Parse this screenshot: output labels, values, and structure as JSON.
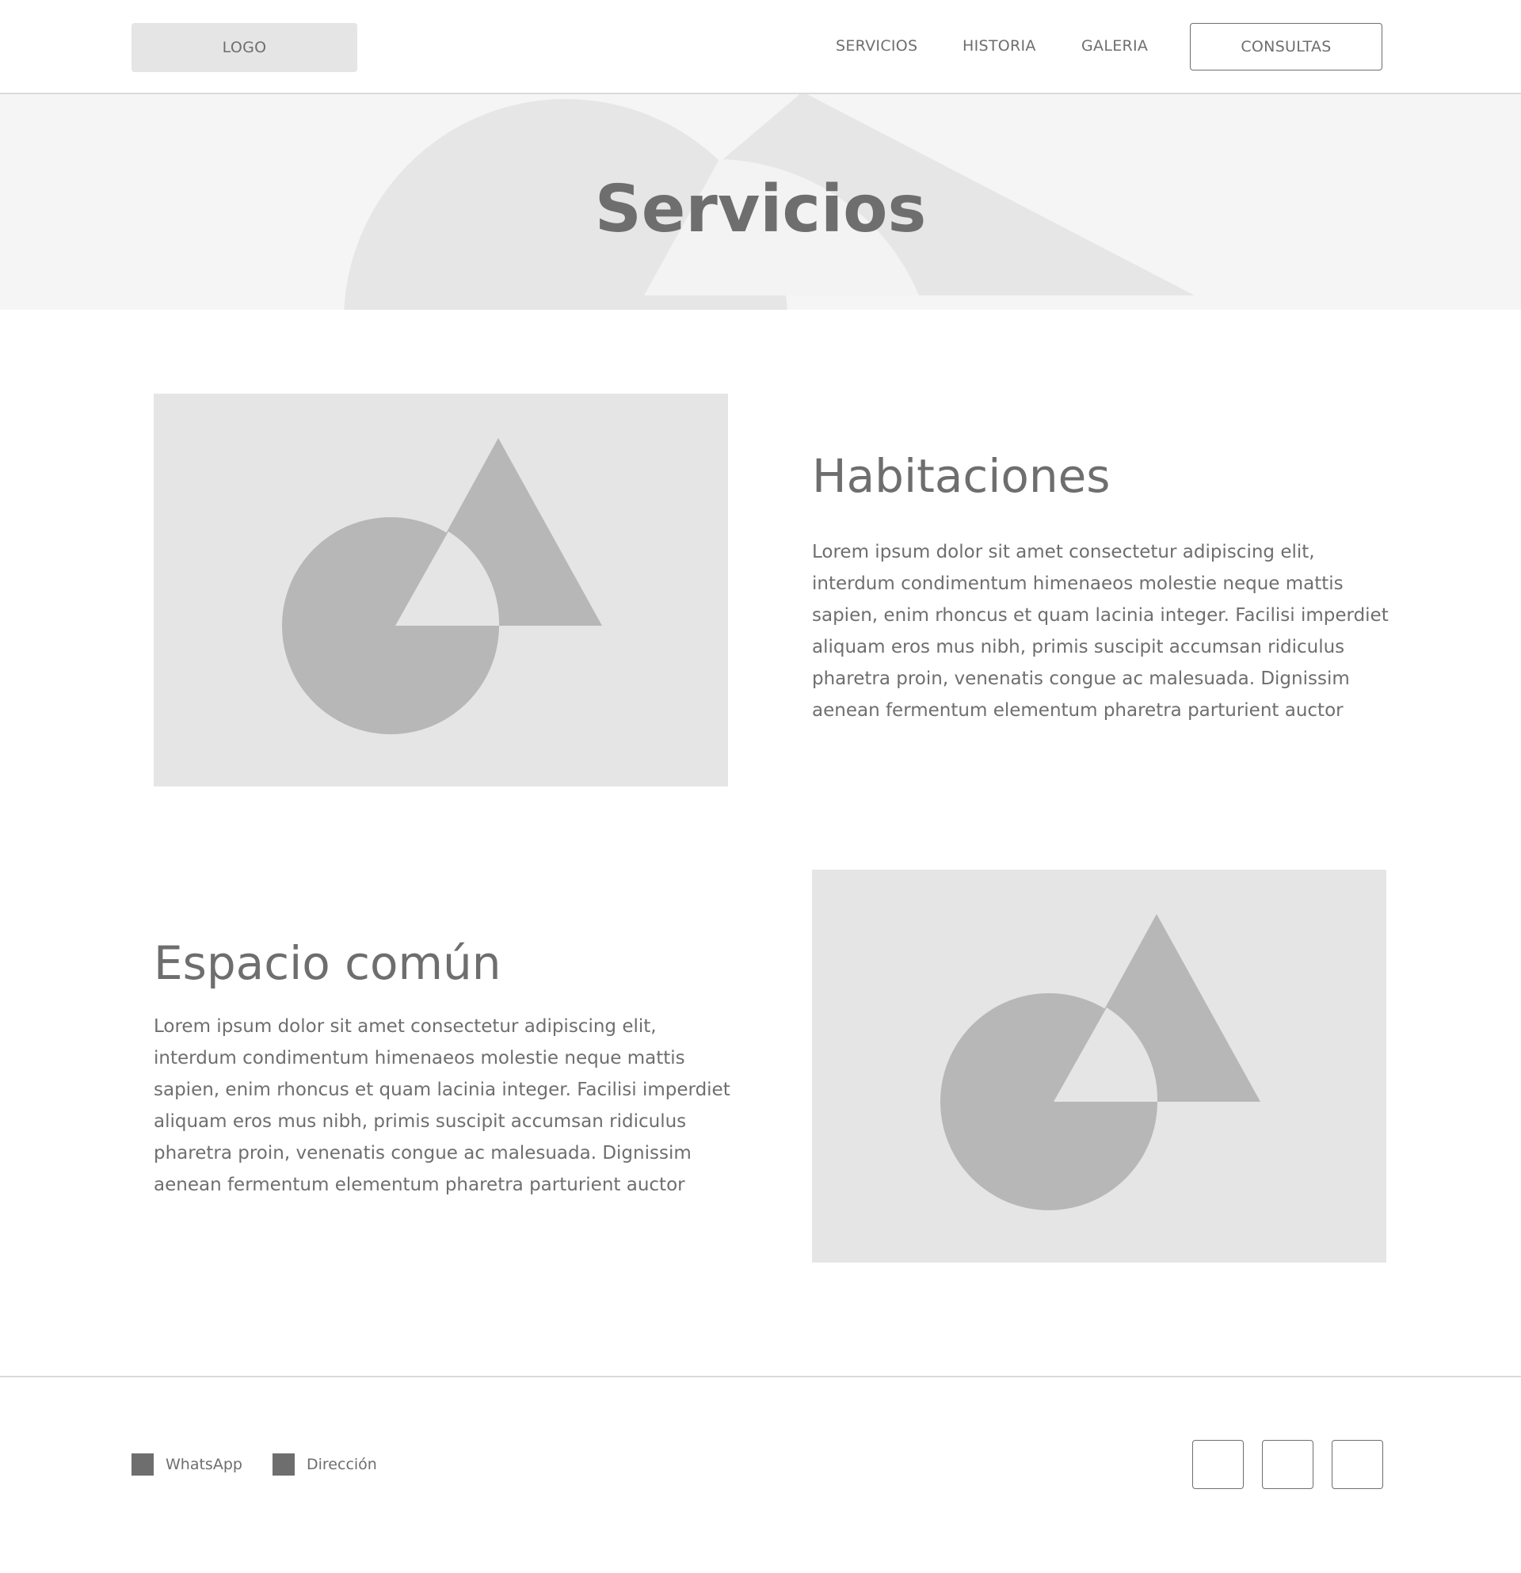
{
  "header": {
    "logo": "LOGO",
    "nav": [
      "SERVICIOS",
      "HISTORIA",
      "GALERIA"
    ],
    "cta": "CONSULTAS"
  },
  "hero": {
    "title": "Servicios"
  },
  "sections": [
    {
      "title": "Habitaciones",
      "text": "Lorem ipsum dolor sit amet consectetur adipiscing elit, interdum condimentum himenaeos molestie neque mattis sapien, enim rhoncus et quam lacinia integer. Facilisi imperdiet aliquam eros mus nibh, primis suscipit accumsan ridiculus pharetra proin, venenatis congue ac malesuada. Dignissim aenean fermentum elementum pharetra parturient auctor",
      "image_icon": "image-placeholder-icon"
    },
    {
      "title": "Espacio común",
      "text": "Lorem ipsum dolor sit amet consectetur adipiscing elit, interdum condimentum himenaeos molestie neque mattis sapien, enim rhoncus et quam lacinia integer. Facilisi imperdiet aliquam eros mus nibh, primis suscipit accumsan ridiculus pharetra proin, venenatis congue ac malesuada. Dignissim aenean fermentum elementum pharetra parturient auctor",
      "image_icon": "image-placeholder-icon"
    }
  ],
  "footer": {
    "contacts": [
      "WhatsApp",
      "Dirección"
    ],
    "social_icons": [
      "social-icon-1",
      "social-icon-2",
      "social-icon-3"
    ]
  },
  "colors": {
    "text": "#6e6e6e",
    "placeholder_bg": "#e5e5e5",
    "placeholder_shape": "#b7b7b7",
    "hero_bg": "#f5f5f5",
    "hero_shape": "#e6e6e6",
    "divider": "#dadada"
  }
}
